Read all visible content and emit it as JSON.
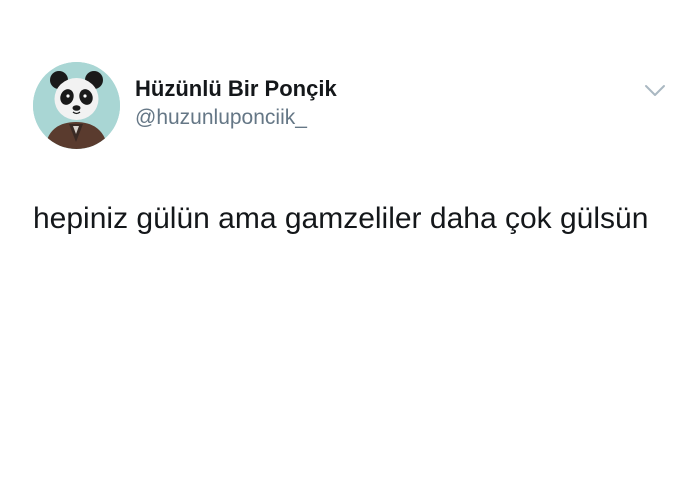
{
  "tweet": {
    "author": {
      "display_name": "Hüzünlü Bir Ponçik",
      "handle": "@huzunluponciik_",
      "avatar_icon": "panda-avatar"
    },
    "text": "hepiniz gülün ama gamzeliler daha çok gülsün",
    "menu_icon": "chevron-down-icon"
  },
  "colors": {
    "background": "#ffffff",
    "name": "#14171a",
    "handle": "#657786",
    "caret": "#aab8c2",
    "avatar_bg": "#a9d6d4"
  }
}
